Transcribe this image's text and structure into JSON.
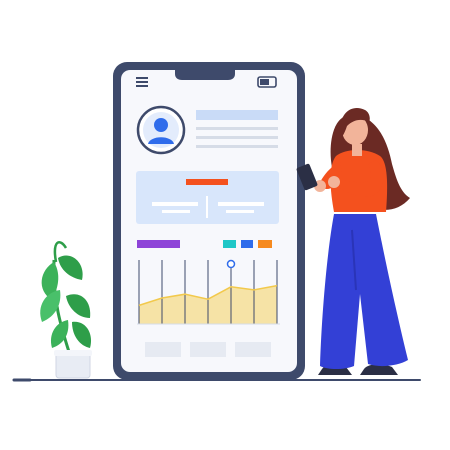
{
  "illustration": {
    "kind": "flat vector illustration of a woman using a phone next to a large smartphone showing a profile dashboard",
    "colors": {
      "phone_frame": "#3E4A6B",
      "screen_bg": "#F7F8FC",
      "panel_blue": "#D8E6FB",
      "accent_orange": "#F4511E",
      "accent_purple": "#8E44D8",
      "accent_teal": "#1FC7C7",
      "accent_blue": "#2F6CEB",
      "chart_fill": "#F6E3A6",
      "avatar_blue": "#2F6CEB",
      "shirt": "#F4511E",
      "pants": "#3340D6",
      "hair": "#6B2A24",
      "plant_green": "#2E9E49",
      "pot": "#E8ECF4"
    },
    "icons": [
      "menu-icon",
      "battery-icon",
      "user-avatar-icon",
      "plant-icon"
    ],
    "chart": {
      "type": "area",
      "values": [
        0.3,
        0.42,
        0.48,
        0.4,
        0.6,
        0.55,
        0.62
      ],
      "marker_index": 4
    }
  }
}
